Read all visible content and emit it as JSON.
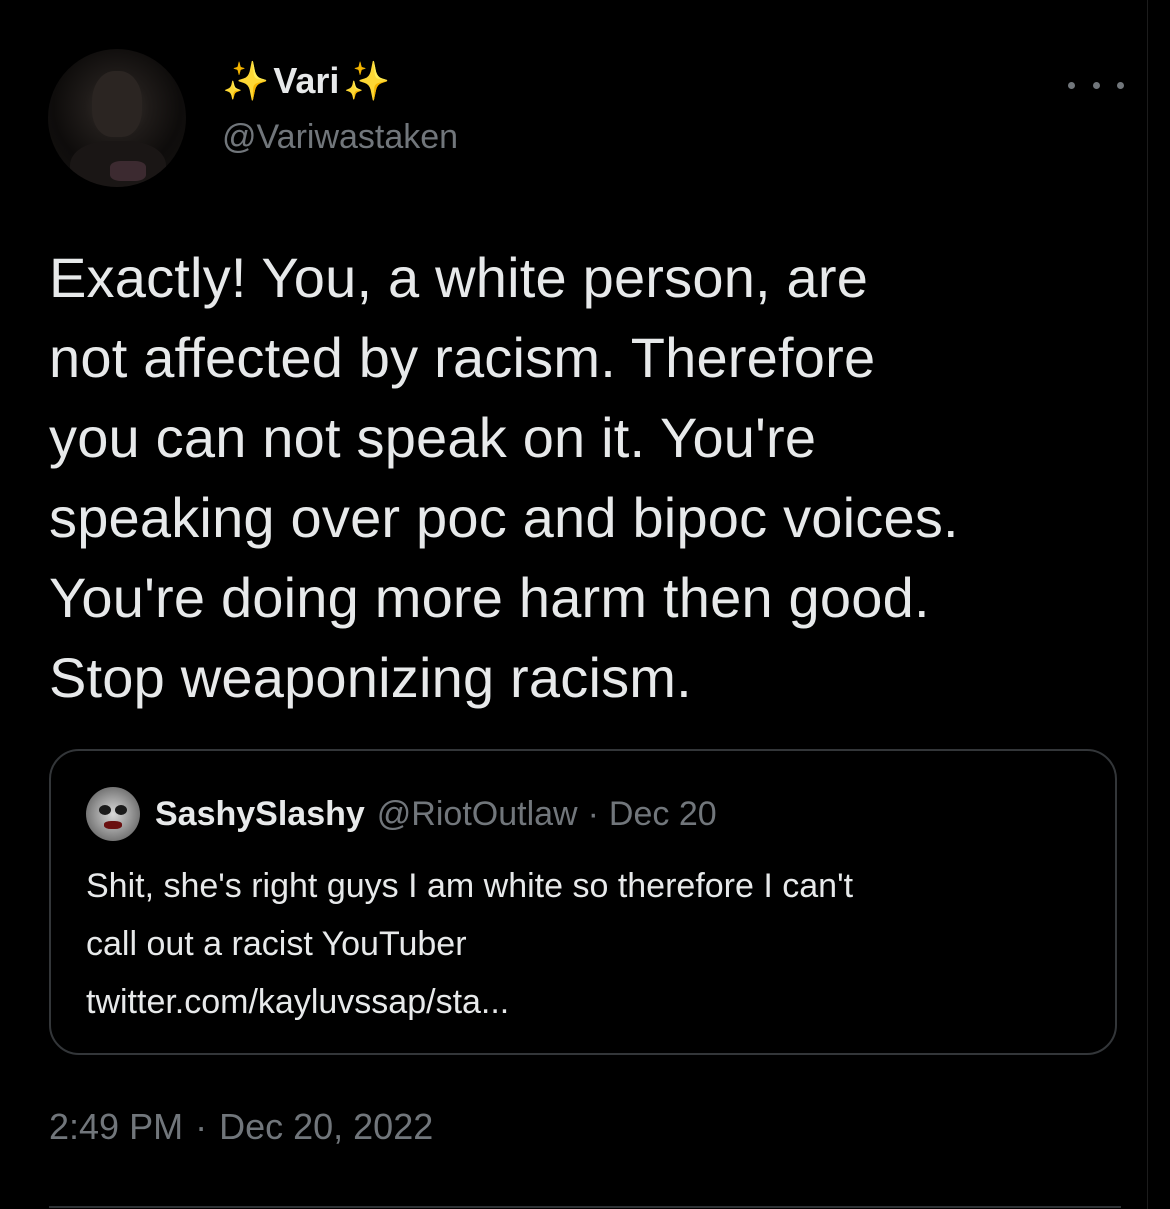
{
  "author": {
    "sparkle_left": "✨",
    "display_name": "Vari",
    "sparkle_right": "✨",
    "handle": "@Variwastaken",
    "avatar_icon": "profile-photo"
  },
  "more_icon": "more-horizontal-icon",
  "tweet": {
    "lines": [
      "Exactly! You, a white person, are",
      "not affected by racism. Therefore",
      "you can not speak on it. You're",
      "speaking over poc and bipoc voices.",
      "You're doing more harm then good.",
      "Stop weaponizing racism."
    ],
    "time": "2:49 PM",
    "separator": "·",
    "date": "Dec 20, 2022"
  },
  "quoted_tweet": {
    "display_name": "SashySlashy",
    "handle": "@RiotOutlaw",
    "separator": "·",
    "date": "Dec 20",
    "lines": [
      "Shit, she's right guys I am white so therefore I can't",
      "call out a racist YouTuber",
      "twitter.com/kayluvssap/sta..."
    ]
  },
  "colors": {
    "background": "#000000",
    "text_primary": "#e7e9ea",
    "text_secondary": "#71767b",
    "border": "#333639",
    "sparkle": "#f5c518"
  }
}
